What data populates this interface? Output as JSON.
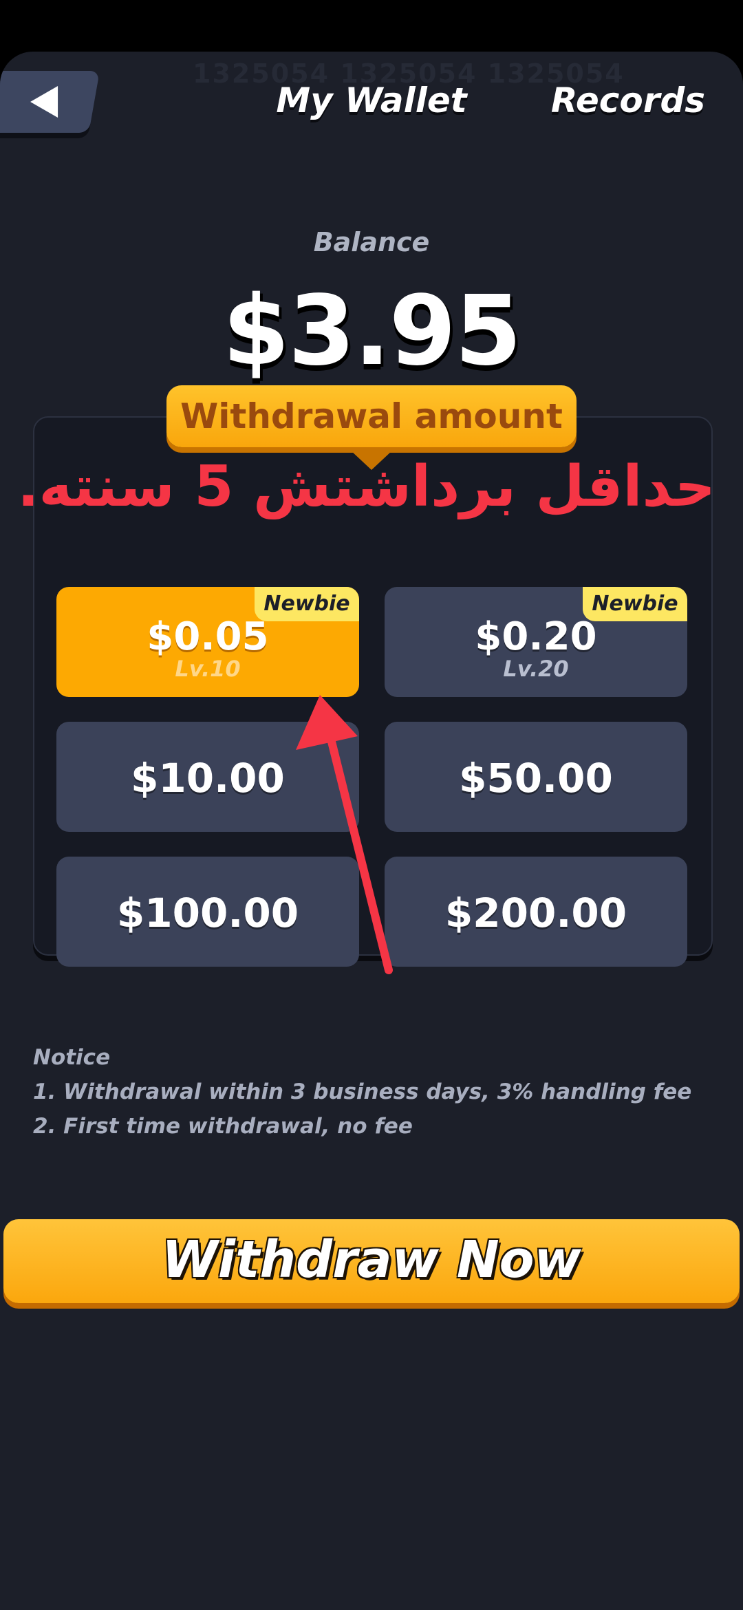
{
  "header": {
    "watermark": "1325054  1325054  1325054",
    "title": "My Wallet",
    "records_label": "Records"
  },
  "balance": {
    "label": "Balance",
    "value": "$3.95"
  },
  "withdrawal": {
    "section_title": "Withdrawal amount",
    "annotation": "حداقل برداشتش 5 سنته.",
    "options": [
      {
        "amount": "$0.05",
        "level": "Lv.10",
        "badge": "Newbie",
        "selected": true
      },
      {
        "amount": "$0.20",
        "level": "Lv.20",
        "badge": "Newbie",
        "selected": false
      },
      {
        "amount": "$10.00"
      },
      {
        "amount": "$50.00"
      },
      {
        "amount": "$100.00"
      },
      {
        "amount": "$200.00"
      }
    ]
  },
  "notice": {
    "title": "Notice",
    "lines": [
      "1.  Withdrawal within 3 business days, 3% handling fee",
      "2. First time withdrawal, no fee"
    ]
  },
  "actions": {
    "withdraw_label": "Withdraw Now"
  },
  "icons": {
    "back": "back-arrow-icon",
    "annotation_arrow": "red-arrow-icon"
  },
  "colors": {
    "background": "#1c1f29",
    "accent": "#fda902",
    "card": "#3b4259",
    "badge": "#fde762",
    "annotation": "#f53545"
  }
}
